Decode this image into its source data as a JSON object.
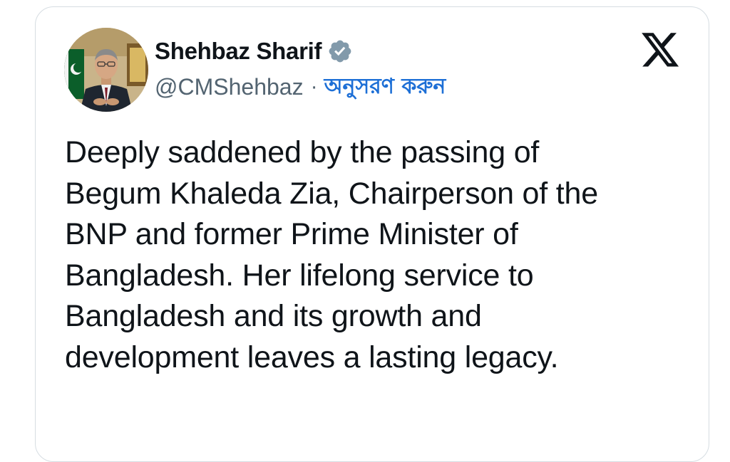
{
  "tweet": {
    "author": {
      "name": "Shehbaz Sharif",
      "handle": "@CMShehbaz",
      "verified_icon": "verified-badge-icon",
      "avatar_icon": "profile-photo"
    },
    "separator": "·",
    "follow_label": "অনুসরণ করুন",
    "platform_icon": "x-logo-icon",
    "text_lines": [
      "Deeply saddened by the passing of",
      "Begum Khaleda Zia, Chairperson of the",
      "BNP and former Prime Minister of",
      "Bangladesh. Her lifelong service to",
      "Bangladesh and its growth and",
      "development leaves a lasting legacy."
    ]
  },
  "colors": {
    "text": "#0f1419",
    "secondary_text": "#536471",
    "follow_link": "#1d6fd6",
    "card_border": "#d6dde2",
    "verified_badge": "#829aab"
  }
}
